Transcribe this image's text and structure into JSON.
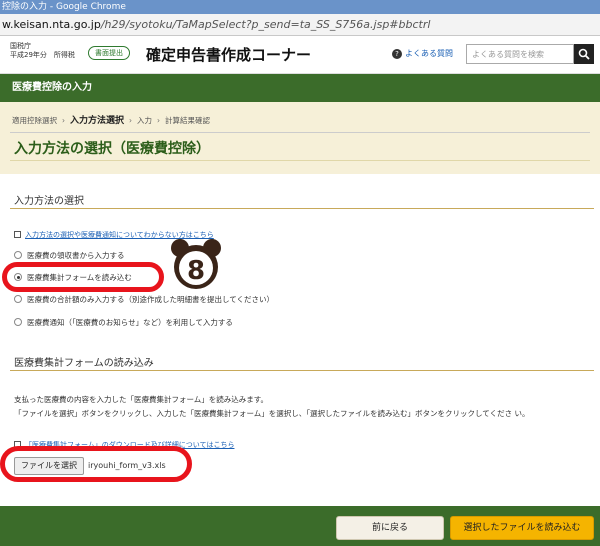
{
  "browser": {
    "window_title": "控除の入力 - Google Chrome",
    "url_domain": "w.keisan.nta.go.jp",
    "url_path": "/h29/syotoku/TaMapSelect?p_send=ta_SS_S756a.jsp#bbctrl"
  },
  "header": {
    "agency_line1": "国税庁",
    "agency_line2": "平成29年分　所得税",
    "badge_label": "書面提出",
    "site_title": "確定申告書作成コーナー",
    "faq_label": "よくある質問",
    "search_placeholder": "よくある質問を検索"
  },
  "section_band": {
    "title": "医療費控除の入力"
  },
  "steps": {
    "items": [
      "適用控除選択",
      "入力方法選択",
      "入力",
      "計算結果確認"
    ],
    "current_index": 1
  },
  "page": {
    "title": "入力方法の選択（医療費控除）"
  },
  "method_section": {
    "heading": "入力方法の選択",
    "help_link": "入力方法の選択や医療費通知についてわからない方はこちら",
    "options": [
      {
        "label": "医療費の領収書から入力する",
        "selected": false
      },
      {
        "label": "医療費集計フォームを読み込む",
        "selected": true
      },
      {
        "label": "医療費の合計額のみ入力する（別途作成した明細書を提出してください）",
        "selected": false
      },
      {
        "label": "医療費通知（「医療費のお知らせ」など）を利用して入力する",
        "selected": false
      }
    ]
  },
  "annotation": {
    "step_number": "8"
  },
  "form_section": {
    "heading": "医療費集計フォームの読み込み",
    "desc_line1": "支払った医療費の内容を入力した「医療費集計フォーム」を読み込みます。",
    "desc_line2": "「ファイルを選択」ボタンをクリックし、入力した「医療費集計フォーム」を選択し、「選択したファイルを読み込む」ボタンをクリックしてくださ い。",
    "download_link": "「医療費集計フォーム」のダウンロード及び詳細についてはこちら",
    "file_button": "ファイルを選択",
    "file_name": "iryouhi_form_v3.xls"
  },
  "footer": {
    "back_button": "前に戻る",
    "load_button": "選択したファイルを読み込む"
  },
  "colors": {
    "brand_green": "#3b6c2a",
    "step_bg": "#f6f0d8",
    "primary_button": "#f5b400",
    "annotation_red": "#e8141c"
  }
}
